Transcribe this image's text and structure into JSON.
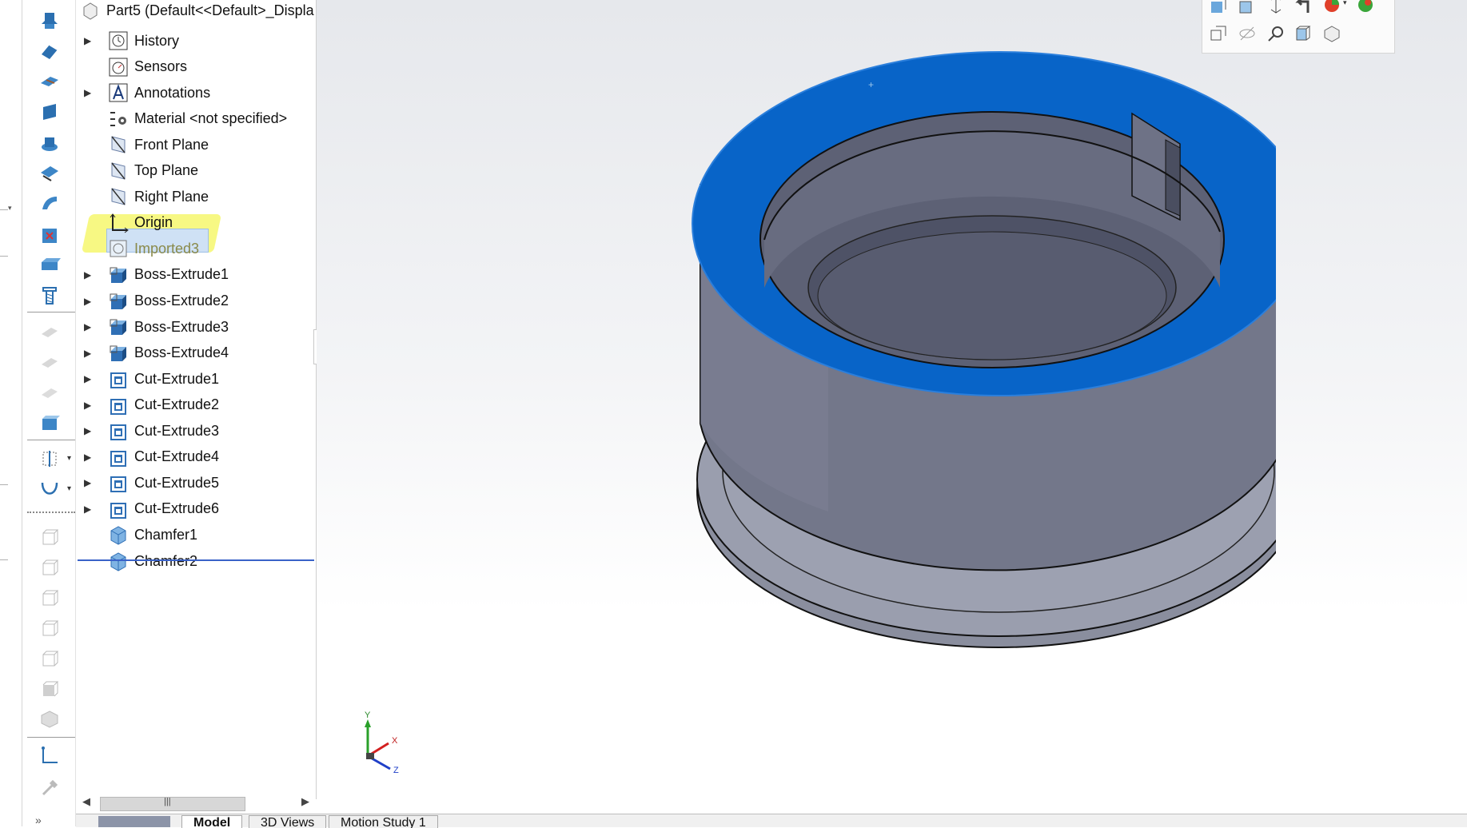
{
  "feature_tree": {
    "part_label": "Part5  (Default<<Default>_Displa",
    "items": [
      {
        "label": "History",
        "icon": "history-icon",
        "expandable": true
      },
      {
        "label": "Sensors",
        "icon": "sensors-icon",
        "expandable": false
      },
      {
        "label": "Annotations",
        "icon": "annotations-icon",
        "expandable": true
      },
      {
        "label": "Material <not specified>",
        "icon": "material-icon",
        "expandable": false
      },
      {
        "label": "Front Plane",
        "icon": "plane-icon",
        "expandable": false
      },
      {
        "label": "Top Plane",
        "icon": "plane-icon",
        "expandable": false
      },
      {
        "label": "Right Plane",
        "icon": "plane-icon",
        "expandable": false
      },
      {
        "label": "Origin",
        "icon": "origin-icon",
        "expandable": false
      },
      {
        "label": "Imported3",
        "icon": "imported-body-icon",
        "expandable": false,
        "selected": true
      },
      {
        "label": "Boss-Extrude1",
        "icon": "boss-extrude-icon",
        "expandable": true
      },
      {
        "label": "Boss-Extrude2",
        "icon": "boss-extrude-icon",
        "expandable": true
      },
      {
        "label": "Boss-Extrude3",
        "icon": "boss-extrude-icon",
        "expandable": true
      },
      {
        "label": "Boss-Extrude4",
        "icon": "boss-extrude-icon",
        "expandable": true
      },
      {
        "label": "Cut-Extrude1",
        "icon": "cut-extrude-icon",
        "expandable": true
      },
      {
        "label": "Cut-Extrude2",
        "icon": "cut-extrude-icon",
        "expandable": true
      },
      {
        "label": "Cut-Extrude3",
        "icon": "cut-extrude-icon",
        "expandable": true
      },
      {
        "label": "Cut-Extrude4",
        "icon": "cut-extrude-icon",
        "expandable": true
      },
      {
        "label": "Cut-Extrude5",
        "icon": "cut-extrude-icon",
        "expandable": true
      },
      {
        "label": "Cut-Extrude6",
        "icon": "cut-extrude-icon",
        "expandable": true
      },
      {
        "label": "Chamfer1",
        "icon": "chamfer-icon",
        "expandable": false
      },
      {
        "label": "Chamfer2",
        "icon": "chamfer-icon",
        "expandable": false
      }
    ],
    "expand_glyph": "▶",
    "scroll_left": "◀",
    "scroll_right": "▶",
    "scroll_grip": "|||"
  },
  "triad": {
    "x": "X",
    "y": "Y",
    "z": "Z"
  },
  "bottom_tabs": [
    {
      "label": "Model",
      "active": true
    },
    {
      "label": "3D Views",
      "active": false
    },
    {
      "label": "Motion Study 1",
      "active": false
    }
  ],
  "colors": {
    "selected_face": "#0a64c8",
    "body_gray": "#7b7f8f",
    "highlight": "#f4f65a",
    "tree_line": "#3a62c8"
  }
}
